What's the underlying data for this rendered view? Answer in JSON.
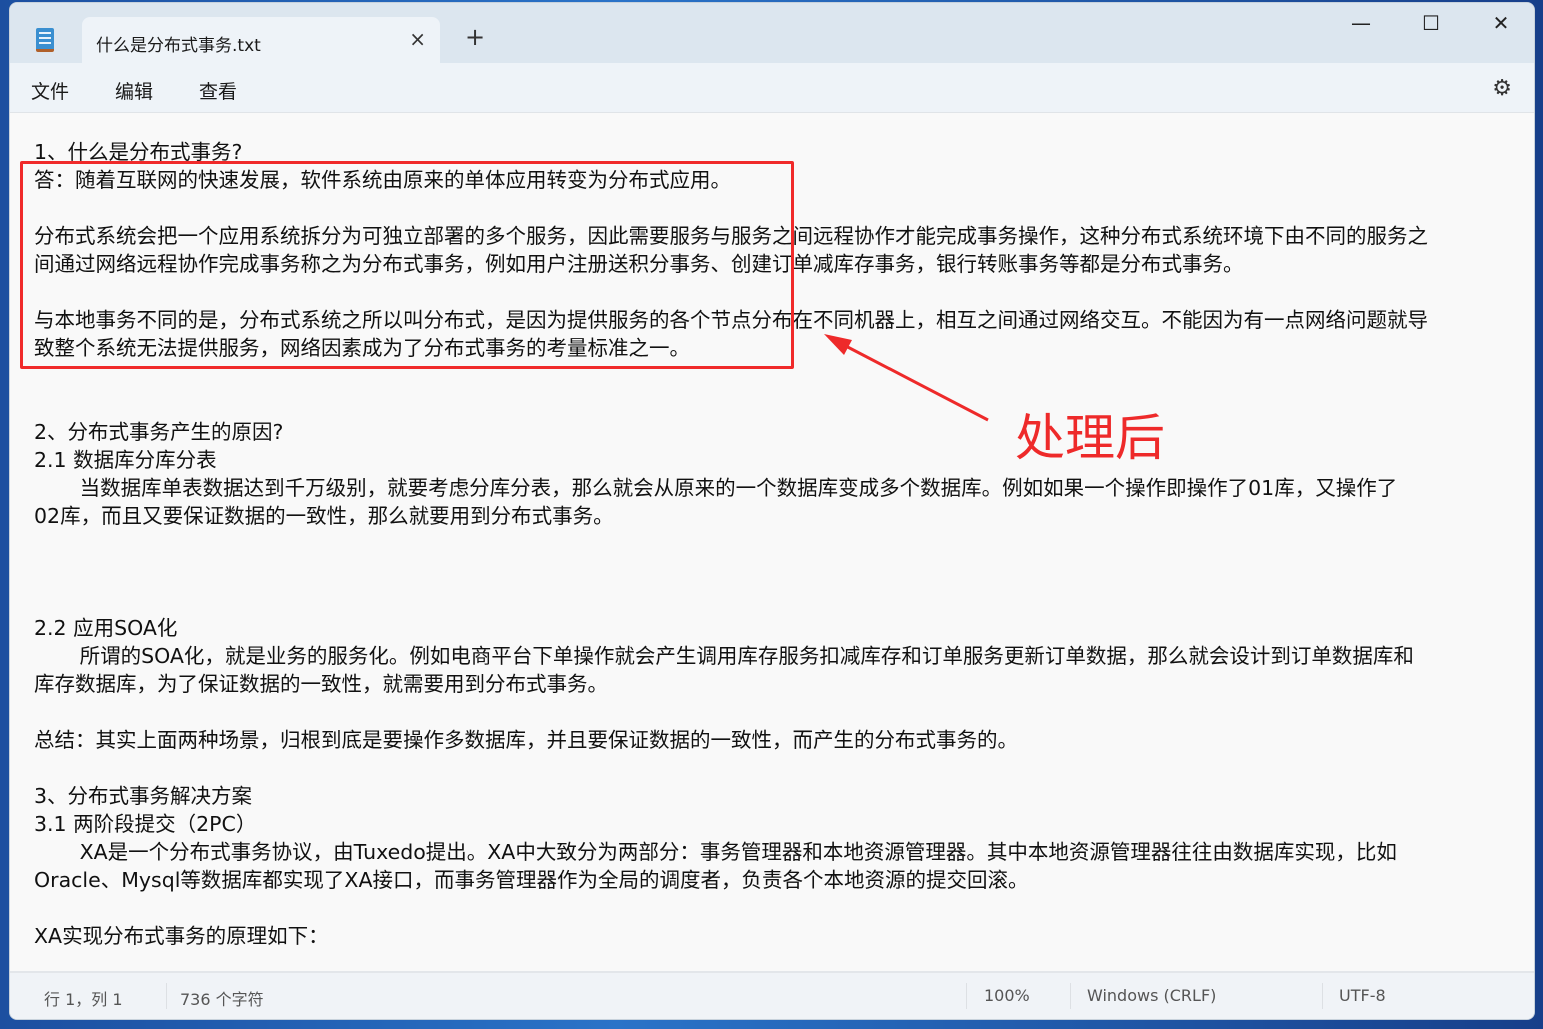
{
  "tab": {
    "title": "什么是分布式事务.txt",
    "close": "×",
    "new_tab": "+"
  },
  "window_controls": {
    "minimize": "—",
    "maximize": "☐",
    "close": "✕"
  },
  "menu": {
    "file": "文件",
    "edit": "编辑",
    "view": "查看",
    "settings": "⚙"
  },
  "content": {
    "lines": [
      "1、什么是分布式事务?",
      "答：随着互联网的快速发展，软件系统由原来的单体应用转变为分布式应用。",
      "",
      "分布式系统会把一个应用系统拆分为可独立部署的多个服务，因此需要服务与服务之间远程协作才能完成事务操作，这种分布式系统环境下由不同的服务之",
      "间通过网络远程协作完成事务称之为分布式事务，例如用户注册送积分事务、创建订单减库存事务，银行转账事务等都是分布式事务。",
      "",
      "与本地事务不同的是，分布式系统之所以叫分布式，是因为提供服务的各个节点分布在不同机器上，相互之间通过网络交互。不能因为有一点网络问题就导",
      "致整个系统无法提供服务，网络因素成为了分布式事务的考量标准之一。",
      "",
      "",
      "2、分布式事务产生的原因?",
      "2.1 数据库分库分表",
      "\t当数据库单表数据达到千万级别，就要考虑分库分表，那么就会从原来的一个数据库变成多个数据库。例如如果一个操作即操作了01库，又操作了",
      "02库，而且又要保证数据的一致性，那么就要用到分布式事务。",
      "",
      "",
      "",
      "2.2 应用SOA化",
      "\t所谓的SOA化，就是业务的服务化。例如电商平台下单操作就会产生调用库存服务扣减库存和订单服务更新订单数据，那么就会设计到订单数据库和",
      "库存数据库，为了保证数据的一致性，就需要用到分布式事务。",
      "",
      "总结：其实上面两种场景，归根到底是要操作多数据库，并且要保证数据的一致性，而产生的分布式事务的。",
      "",
      "3、分布式事务解决方案",
      "3.1 两阶段提交（2PC）",
      "\tXA是一个分布式事务协议，由Tuxedo提出。XA中大致分为两部分：事务管理器和本地资源管理器。其中本地资源管理器往往由数据库实现，比如",
      "Oracle、Mysql等数据库都实现了XA接口，而事务管理器作为全局的调度者，负责各个本地资源的提交回滚。",
      "",
      "XA实现分布式事务的原理如下："
    ]
  },
  "annotation": {
    "label": "处理后",
    "color": "#ee2a2a"
  },
  "status": {
    "position": "行 1，列 1",
    "chars": "736 个字符",
    "zoom": "100%",
    "line_ending": "Windows (CRLF)",
    "encoding": "UTF-8"
  }
}
